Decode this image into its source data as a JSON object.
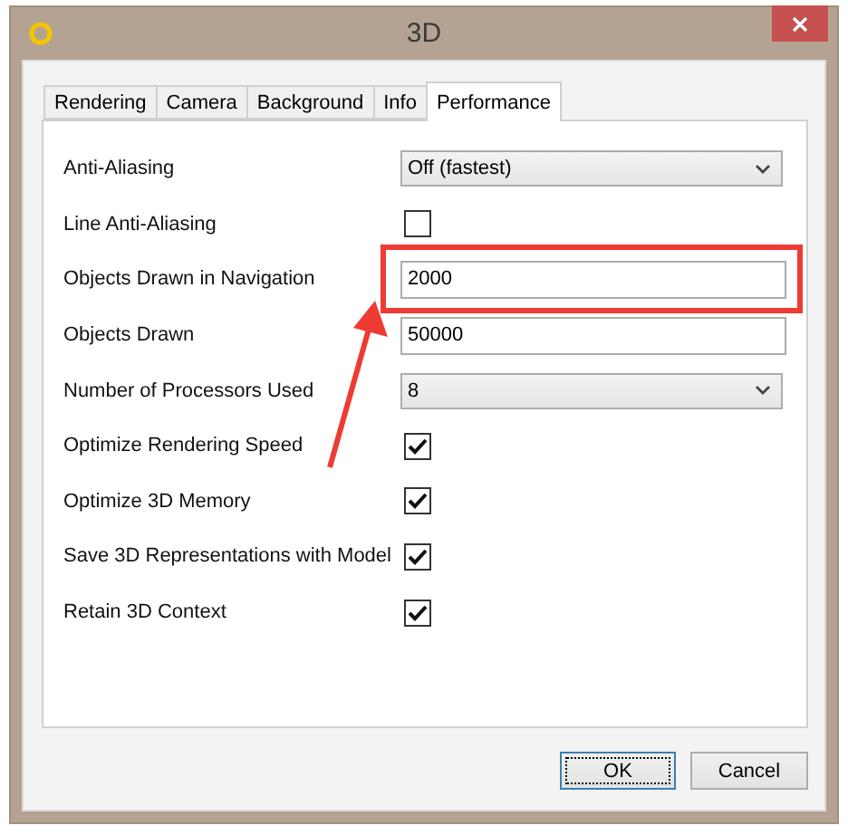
{
  "window": {
    "title": "3D"
  },
  "tabs": [
    {
      "label": "Rendering",
      "selected": false
    },
    {
      "label": "Camera",
      "selected": false
    },
    {
      "label": "Background",
      "selected": false
    },
    {
      "label": "Info",
      "selected": false
    },
    {
      "label": "Performance",
      "selected": true
    }
  ],
  "rows": [
    {
      "kind": "select",
      "label": "Anti-Aliasing",
      "value": "Off (fastest)"
    },
    {
      "kind": "checkbox",
      "label": "Line Anti-Aliasing",
      "checked": false
    },
    {
      "kind": "text",
      "label": "Objects Drawn in Navigation",
      "value": "2000",
      "highlighted": true
    },
    {
      "kind": "text",
      "label": "Objects Drawn",
      "value": "50000",
      "highlighted": false
    },
    {
      "kind": "select",
      "label": "Number of Processors Used",
      "value": "8"
    },
    {
      "kind": "checkbox",
      "label": "Optimize Rendering Speed",
      "checked": true
    },
    {
      "kind": "checkbox",
      "label": "Optimize 3D Memory",
      "checked": true
    },
    {
      "kind": "checkbox",
      "label": "Save 3D Representations with Model",
      "checked": true
    },
    {
      "kind": "checkbox",
      "label": "Retain 3D Context",
      "checked": true
    }
  ],
  "buttons": [
    {
      "label": "OK",
      "focused": true
    },
    {
      "label": "Cancel",
      "focused": false
    }
  ]
}
